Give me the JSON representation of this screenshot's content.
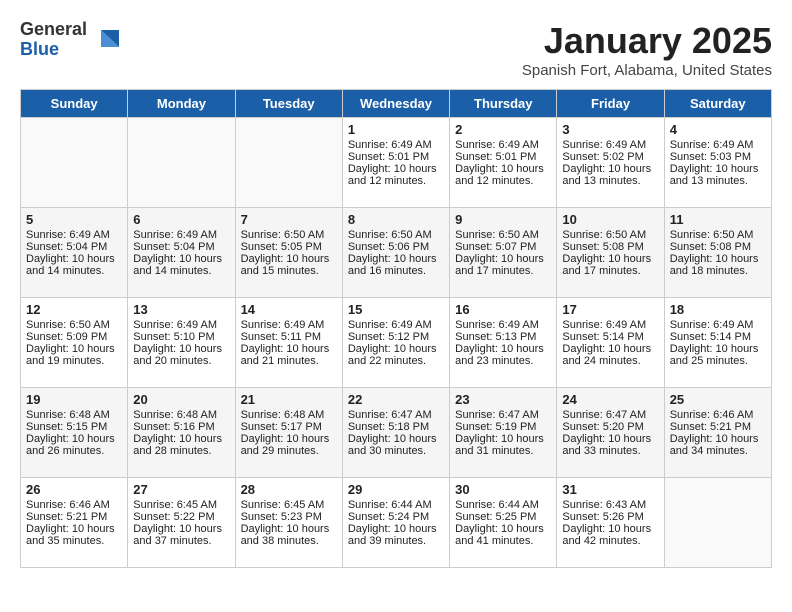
{
  "header": {
    "logo_general": "General",
    "logo_blue": "Blue",
    "title": "January 2025",
    "location": "Spanish Fort, Alabama, United States"
  },
  "days_of_week": [
    "Sunday",
    "Monday",
    "Tuesday",
    "Wednesday",
    "Thursday",
    "Friday",
    "Saturday"
  ],
  "weeks": [
    [
      {
        "day": "",
        "content": ""
      },
      {
        "day": "",
        "content": ""
      },
      {
        "day": "",
        "content": ""
      },
      {
        "day": "1",
        "content": "Sunrise: 6:49 AM\nSunset: 5:01 PM\nDaylight: 10 hours\nand 12 minutes."
      },
      {
        "day": "2",
        "content": "Sunrise: 6:49 AM\nSunset: 5:01 PM\nDaylight: 10 hours\nand 12 minutes."
      },
      {
        "day": "3",
        "content": "Sunrise: 6:49 AM\nSunset: 5:02 PM\nDaylight: 10 hours\nand 13 minutes."
      },
      {
        "day": "4",
        "content": "Sunrise: 6:49 AM\nSunset: 5:03 PM\nDaylight: 10 hours\nand 13 minutes."
      }
    ],
    [
      {
        "day": "5",
        "content": "Sunrise: 6:49 AM\nSunset: 5:04 PM\nDaylight: 10 hours\nand 14 minutes."
      },
      {
        "day": "6",
        "content": "Sunrise: 6:49 AM\nSunset: 5:04 PM\nDaylight: 10 hours\nand 14 minutes."
      },
      {
        "day": "7",
        "content": "Sunrise: 6:50 AM\nSunset: 5:05 PM\nDaylight: 10 hours\nand 15 minutes."
      },
      {
        "day": "8",
        "content": "Sunrise: 6:50 AM\nSunset: 5:06 PM\nDaylight: 10 hours\nand 16 minutes."
      },
      {
        "day": "9",
        "content": "Sunrise: 6:50 AM\nSunset: 5:07 PM\nDaylight: 10 hours\nand 17 minutes."
      },
      {
        "day": "10",
        "content": "Sunrise: 6:50 AM\nSunset: 5:08 PM\nDaylight: 10 hours\nand 17 minutes."
      },
      {
        "day": "11",
        "content": "Sunrise: 6:50 AM\nSunset: 5:08 PM\nDaylight: 10 hours\nand 18 minutes."
      }
    ],
    [
      {
        "day": "12",
        "content": "Sunrise: 6:50 AM\nSunset: 5:09 PM\nDaylight: 10 hours\nand 19 minutes."
      },
      {
        "day": "13",
        "content": "Sunrise: 6:49 AM\nSunset: 5:10 PM\nDaylight: 10 hours\nand 20 minutes."
      },
      {
        "day": "14",
        "content": "Sunrise: 6:49 AM\nSunset: 5:11 PM\nDaylight: 10 hours\nand 21 minutes."
      },
      {
        "day": "15",
        "content": "Sunrise: 6:49 AM\nSunset: 5:12 PM\nDaylight: 10 hours\nand 22 minutes."
      },
      {
        "day": "16",
        "content": "Sunrise: 6:49 AM\nSunset: 5:13 PM\nDaylight: 10 hours\nand 23 minutes."
      },
      {
        "day": "17",
        "content": "Sunrise: 6:49 AM\nSunset: 5:14 PM\nDaylight: 10 hours\nand 24 minutes."
      },
      {
        "day": "18",
        "content": "Sunrise: 6:49 AM\nSunset: 5:14 PM\nDaylight: 10 hours\nand 25 minutes."
      }
    ],
    [
      {
        "day": "19",
        "content": "Sunrise: 6:48 AM\nSunset: 5:15 PM\nDaylight: 10 hours\nand 26 minutes."
      },
      {
        "day": "20",
        "content": "Sunrise: 6:48 AM\nSunset: 5:16 PM\nDaylight: 10 hours\nand 28 minutes."
      },
      {
        "day": "21",
        "content": "Sunrise: 6:48 AM\nSunset: 5:17 PM\nDaylight: 10 hours\nand 29 minutes."
      },
      {
        "day": "22",
        "content": "Sunrise: 6:47 AM\nSunset: 5:18 PM\nDaylight: 10 hours\nand 30 minutes."
      },
      {
        "day": "23",
        "content": "Sunrise: 6:47 AM\nSunset: 5:19 PM\nDaylight: 10 hours\nand 31 minutes."
      },
      {
        "day": "24",
        "content": "Sunrise: 6:47 AM\nSunset: 5:20 PM\nDaylight: 10 hours\nand 33 minutes."
      },
      {
        "day": "25",
        "content": "Sunrise: 6:46 AM\nSunset: 5:21 PM\nDaylight: 10 hours\nand 34 minutes."
      }
    ],
    [
      {
        "day": "26",
        "content": "Sunrise: 6:46 AM\nSunset: 5:21 PM\nDaylight: 10 hours\nand 35 minutes."
      },
      {
        "day": "27",
        "content": "Sunrise: 6:45 AM\nSunset: 5:22 PM\nDaylight: 10 hours\nand 37 minutes."
      },
      {
        "day": "28",
        "content": "Sunrise: 6:45 AM\nSunset: 5:23 PM\nDaylight: 10 hours\nand 38 minutes."
      },
      {
        "day": "29",
        "content": "Sunrise: 6:44 AM\nSunset: 5:24 PM\nDaylight: 10 hours\nand 39 minutes."
      },
      {
        "day": "30",
        "content": "Sunrise: 6:44 AM\nSunset: 5:25 PM\nDaylight: 10 hours\nand 41 minutes."
      },
      {
        "day": "31",
        "content": "Sunrise: 6:43 AM\nSunset: 5:26 PM\nDaylight: 10 hours\nand 42 minutes."
      },
      {
        "day": "",
        "content": ""
      }
    ]
  ]
}
